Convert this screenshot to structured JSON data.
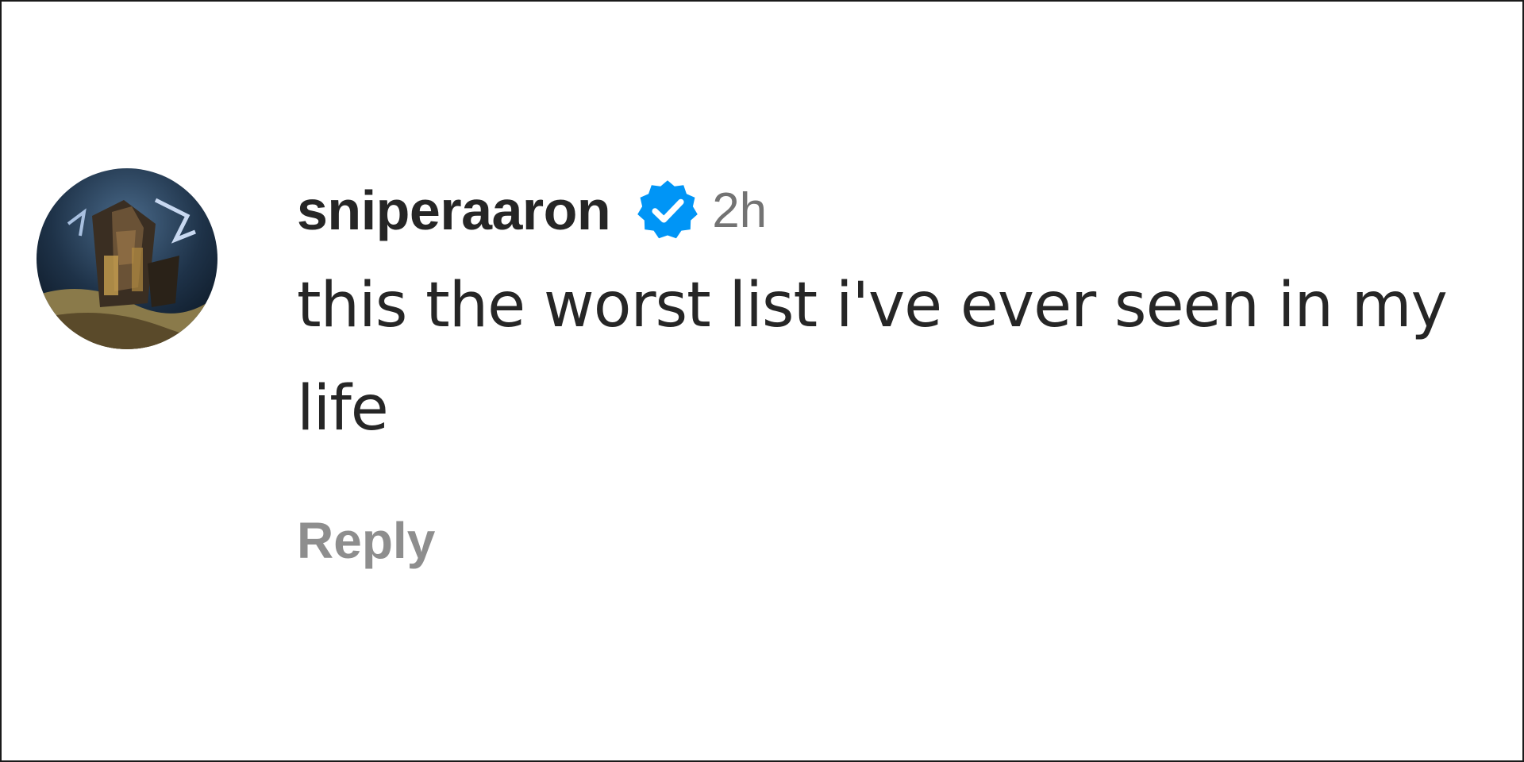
{
  "comment": {
    "username": "sniperaaron",
    "verified": true,
    "timestamp": "2h",
    "text": "this the worst list i've ever seen in my life",
    "reply_label": "Reply"
  },
  "icons": {
    "verified_badge": "verified-check-icon",
    "avatar": "profile-avatar"
  },
  "colors": {
    "text_primary": "#262626",
    "text_secondary": "#737373",
    "reply_gray": "#8e8e8e",
    "verified_blue": "#0095f6"
  }
}
